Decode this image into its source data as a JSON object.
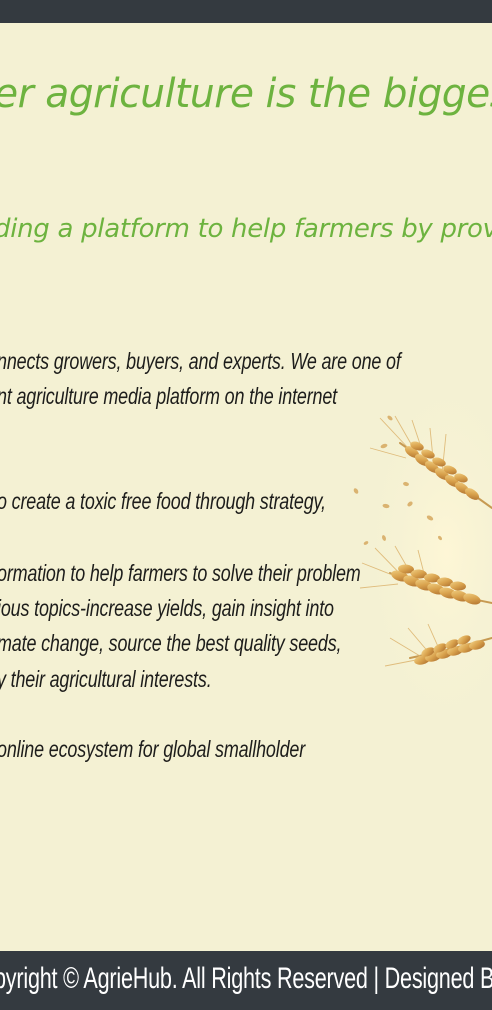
{
  "hero": {
    "title": "er agriculture is the biggest",
    "subtitle": "ding a platform to help farmers by providi"
  },
  "about": {
    "lines": [
      "nnects growers, buyers, and experts. We are one of",
      "nt agriculture media platform on the internet",
      "o create a toxic free food through strategy,",
      "ormation to help farmers to solve their problem",
      "ious topics-increase yields, gain insight into",
      "mate change, source the best quality seeds,",
      "y their agricultural interests.",
      "online ecosystem for global smallholder"
    ]
  },
  "images": {
    "wheat": "wheat-ears-illustration"
  },
  "footer": {
    "text": "pyright © AgrieHub. All Rights Reserved | Designed By Archa"
  },
  "colors": {
    "background": "#f4f1d3",
    "bars": "#343a40",
    "accent": "#6db33f",
    "text": "#1d1d1b"
  }
}
